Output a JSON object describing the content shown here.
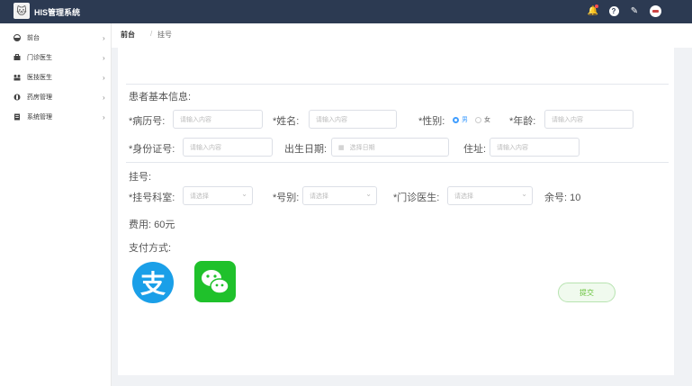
{
  "app": {
    "title": "HIS管理系统"
  },
  "sidebar": {
    "items": [
      {
        "label": "前台",
        "icon": "desk-icon"
      },
      {
        "label": "门诊医生",
        "icon": "briefcase-icon"
      },
      {
        "label": "医技医生",
        "icon": "group-icon"
      },
      {
        "label": "药房管理",
        "icon": "pill-icon"
      },
      {
        "label": "系统管理",
        "icon": "document-icon"
      }
    ]
  },
  "breadcrumb": {
    "home": "前台",
    "separator": "/",
    "current": "挂号"
  },
  "patient": {
    "section_title": "患者基本信息:",
    "record_no": {
      "label": "*病历号:",
      "placeholder": "请输入内容"
    },
    "name": {
      "label": "*姓名:",
      "placeholder": "请输入内容"
    },
    "gender": {
      "label": "*性别:",
      "options": [
        "男",
        "女"
      ],
      "selected": "男"
    },
    "age": {
      "label": "*年龄:",
      "placeholder": "请输入内容"
    },
    "id_card": {
      "label": "*身份证号:",
      "placeholder": "请输入内容"
    },
    "birth_date": {
      "label": "出生日期:",
      "placeholder": "选择日期"
    },
    "address": {
      "label": "住址:",
      "placeholder": "请输入内容"
    }
  },
  "registration": {
    "section_title": "挂号:",
    "department": {
      "label": "*挂号科室:",
      "placeholder": "请选择"
    },
    "reg_type": {
      "label": "*号别:",
      "placeholder": "请选择"
    },
    "doctor": {
      "label": "*门诊医生:",
      "placeholder": "请选择"
    },
    "remaining": "余号: 10",
    "fee": "费用: 60元"
  },
  "payment": {
    "label": "支付方式:",
    "alipay_glyph": "支",
    "methods": [
      "alipay-icon",
      "wechat-pay-icon"
    ]
  },
  "submit_label": "提交",
  "colors": {
    "topbar": "#2c3a52",
    "accent": "#409eff",
    "alipay": "#1a9fe8",
    "wechat": "#1fc12b",
    "submit_text": "#67c23a"
  }
}
